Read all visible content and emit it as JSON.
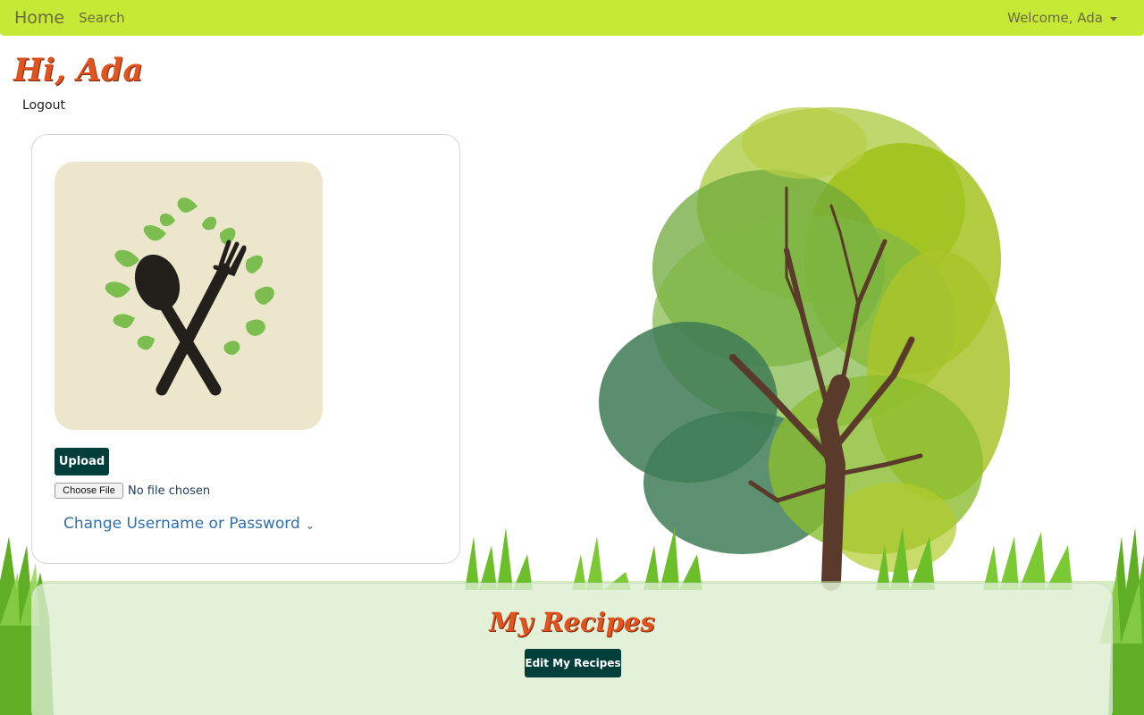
{
  "navbar": {
    "home_label": "Home",
    "search_label": "Search",
    "welcome_label": "Welcome, Ada"
  },
  "greeting": {
    "title": "Hi, Ada",
    "logout_label": "Logout"
  },
  "profile": {
    "upload_label": "Upload",
    "choose_file_label": "Choose File",
    "file_status": "No file chosen",
    "change_credentials_label": "Change Username or Password"
  },
  "recipes": {
    "title": "My Recipes",
    "edit_label": "Edit My Recipes"
  },
  "colors": {
    "navbar": "#c6e935",
    "accent_orange": "#e2541f",
    "button_dark_teal": "#023f3a",
    "link_blue": "#2f6fb0"
  },
  "icons": {
    "avatar": "spoon-fork-leaves-icon",
    "caret": "caret-down-icon",
    "chevron": "chevron-down-icon"
  }
}
